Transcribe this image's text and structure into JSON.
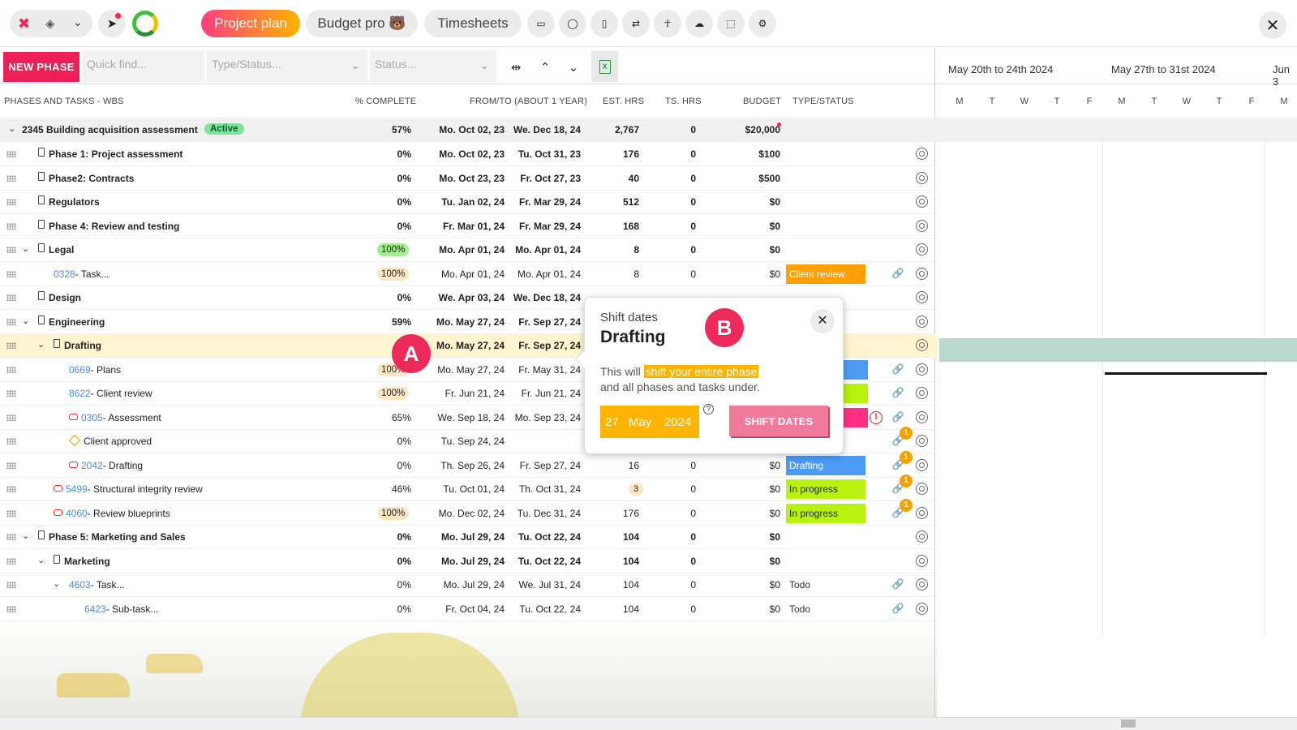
{
  "tabs": {
    "project_plan": "Project plan",
    "budget_pro": "Budget pro 🐻",
    "timesheets": "Timesheets"
  },
  "toolbar": {
    "new_phase": "NEW PHASE",
    "quick_find": "Quick find...",
    "type_status": "Type/Status...",
    "status": "Status..."
  },
  "gantt_weeks": [
    "May 20th to 24th 2024",
    "May 27th to 31st 2024",
    "Jun 3"
  ],
  "gantt_days": [
    "M",
    "T",
    "W",
    "T",
    "F",
    "M",
    "T",
    "W",
    "T",
    "F",
    "M"
  ],
  "columns": {
    "wbs": "PHASES AND TASKS - WBS",
    "pct": "% COMPLETE",
    "fromto": "FROM/TO (ABOUT 1 YEAR)",
    "est": "EST. HRS",
    "ts": "TS. HRS",
    "budget": "BUDGET",
    "type": "TYPE/STATUS"
  },
  "project": {
    "name": "2345 Building acquisition assessment",
    "badge": "Active",
    "pct": "57%",
    "from": "Mo. Oct 02, 23",
    "to": "We. Dec 18, 24",
    "est": "2,767",
    "ts": "0",
    "budget": "$20,000"
  },
  "rows": [
    {
      "num": "",
      "name": "Phase 1: Project assessment",
      "pct": "0%",
      "from": "Mo. Oct 02, 23",
      "to": "Tu. Oct 31, 23",
      "est": "176",
      "ts": "0",
      "budget": "$100",
      "status": ""
    },
    {
      "num": "",
      "name": "Phase2: Contracts",
      "pct": "0%",
      "from": "Mo. Oct 23, 23",
      "to": "Fr. Oct 27, 23",
      "est": "40",
      "ts": "0",
      "budget": "$500",
      "status": ""
    },
    {
      "num": "",
      "name": "Regulators",
      "pct": "0%",
      "from": "Tu. Jan 02, 24",
      "to": "Fr. Mar 29, 24",
      "est": "512",
      "ts": "0",
      "budget": "$0",
      "status": ""
    },
    {
      "num": "",
      "name": "Phase 4: Review and testing",
      "pct": "0%",
      "from": "Fr. Mar 01, 24",
      "to": "Fr. Mar 29, 24",
      "est": "168",
      "ts": "0",
      "budget": "$0",
      "status": ""
    },
    {
      "num": "",
      "name": "Legal",
      "pct": "100%",
      "from": "Mo. Apr 01, 24",
      "to": "Mo. Apr 01, 24",
      "est": "8",
      "ts": "0",
      "budget": "$0",
      "status": ""
    },
    {
      "num": "0328",
      "name": "- Task...",
      "pct": "100%",
      "from": "Mo. Apr 01, 24",
      "to": "Mo. Apr 01, 24",
      "est": "8",
      "ts": "0",
      "budget": "$0",
      "status": "Client review"
    },
    {
      "num": "",
      "name": "Design",
      "pct": "0%",
      "from": "We. Apr 03, 24",
      "to": "We. Dec 18, 24",
      "est": "",
      "ts": "",
      "budget": "",
      "status": ""
    },
    {
      "num": "",
      "name": "Engineering",
      "pct": "59%",
      "from": "Mo. May 27, 24",
      "to": "Fr. Sep 27, 24",
      "est": "",
      "ts": "",
      "budget": "",
      "status": ""
    },
    {
      "num": "",
      "name": "Drafting",
      "pct": "",
      "from": "Mo. May 27, 24",
      "to": "Fr. Sep 27, 24",
      "est": "",
      "ts": "",
      "budget": "",
      "status": ""
    },
    {
      "num": "0669",
      "name": "- Plans",
      "pct": "100%",
      "from": "Mo. May 27, 24",
      "to": "Fr. May 31, 24",
      "est": "",
      "ts": "",
      "budget": "",
      "status": ""
    },
    {
      "num": "8622",
      "name": "- Client review",
      "pct": "100%",
      "from": "Fr. Jun 21, 24",
      "to": "Fr. Jun 21, 24",
      "est": "",
      "ts": "",
      "budget": "",
      "status": ""
    },
    {
      "num": "0305",
      "name": "- Assessment",
      "pct": "65%",
      "from": "We. Sep 18, 24",
      "to": "Mo. Sep 23, 24",
      "est": "",
      "ts": "",
      "budget": "",
      "status": ""
    },
    {
      "num": "",
      "name": "Client approved",
      "pct": "0%",
      "from": "Tu. Sep 24, 24",
      "to": "",
      "est": "",
      "ts": "",
      "budget": "",
      "status": ""
    },
    {
      "num": "2042",
      "name": "- Drafting",
      "pct": "0%",
      "from": "Th. Sep 26, 24",
      "to": "Fr. Sep 27, 24",
      "est": "16",
      "ts": "0",
      "budget": "$0",
      "status": "Drafting"
    },
    {
      "num": "5499",
      "name": "- Structural integrity review",
      "pct": "46%",
      "from": "Tu. Oct 01, 24",
      "to": "Th. Oct 31, 24",
      "est": "3",
      "ts": "0",
      "budget": "$0",
      "status": "In progress"
    },
    {
      "num": "4060",
      "name": "- Review blueprints",
      "pct": "100%",
      "from": "Mo. Dec 02, 24",
      "to": "Tu. Dec 31, 24",
      "est": "176",
      "ts": "0",
      "budget": "$0",
      "status": "In progress"
    },
    {
      "num": "",
      "name": "Phase 5: Marketing and Sales",
      "pct": "0%",
      "from": "Mo. Jul 29, 24",
      "to": "Tu. Oct 22, 24",
      "est": "104",
      "ts": "0",
      "budget": "$0",
      "status": ""
    },
    {
      "num": "",
      "name": "Marketing",
      "pct": "0%",
      "from": "Mo. Jul 29, 24",
      "to": "Tu. Oct 22, 24",
      "est": "104",
      "ts": "0",
      "budget": "$0",
      "status": ""
    },
    {
      "num": "4603",
      "name": "- Task...",
      "pct": "0%",
      "from": "Mo. Jul 29, 24",
      "to": "We. Jul 31, 24",
      "est": "104",
      "ts": "0",
      "budget": "$0",
      "status": "Todo"
    },
    {
      "num": "6423",
      "name": "- Sub-task...",
      "pct": "0%",
      "from": "Fr. Oct 04, 24",
      "to": "Tu. Oct 22, 24",
      "est": "104",
      "ts": "0",
      "budget": "$0",
      "status": "Todo"
    }
  ],
  "notif_count": "1",
  "popup": {
    "subtitle": "Shift dates",
    "title": "Drafting",
    "text_pre": "This will ",
    "text_hl": "shift your entire phase",
    "text_post": "and all phases and tasks under.",
    "day": "27",
    "month": "May",
    "year": "2024",
    "button": "SHIFT DATES",
    "help": "?"
  },
  "markers": {
    "a": "A",
    "b": "B"
  },
  "colors": {
    "accent": "#ee1e56",
    "client_review": "#ffa000",
    "drafting": "#4c9cf5",
    "in_progress": "#b9f20f",
    "assessment": "#ff2f86",
    "gantt_highlight": "#b8d9cd"
  }
}
